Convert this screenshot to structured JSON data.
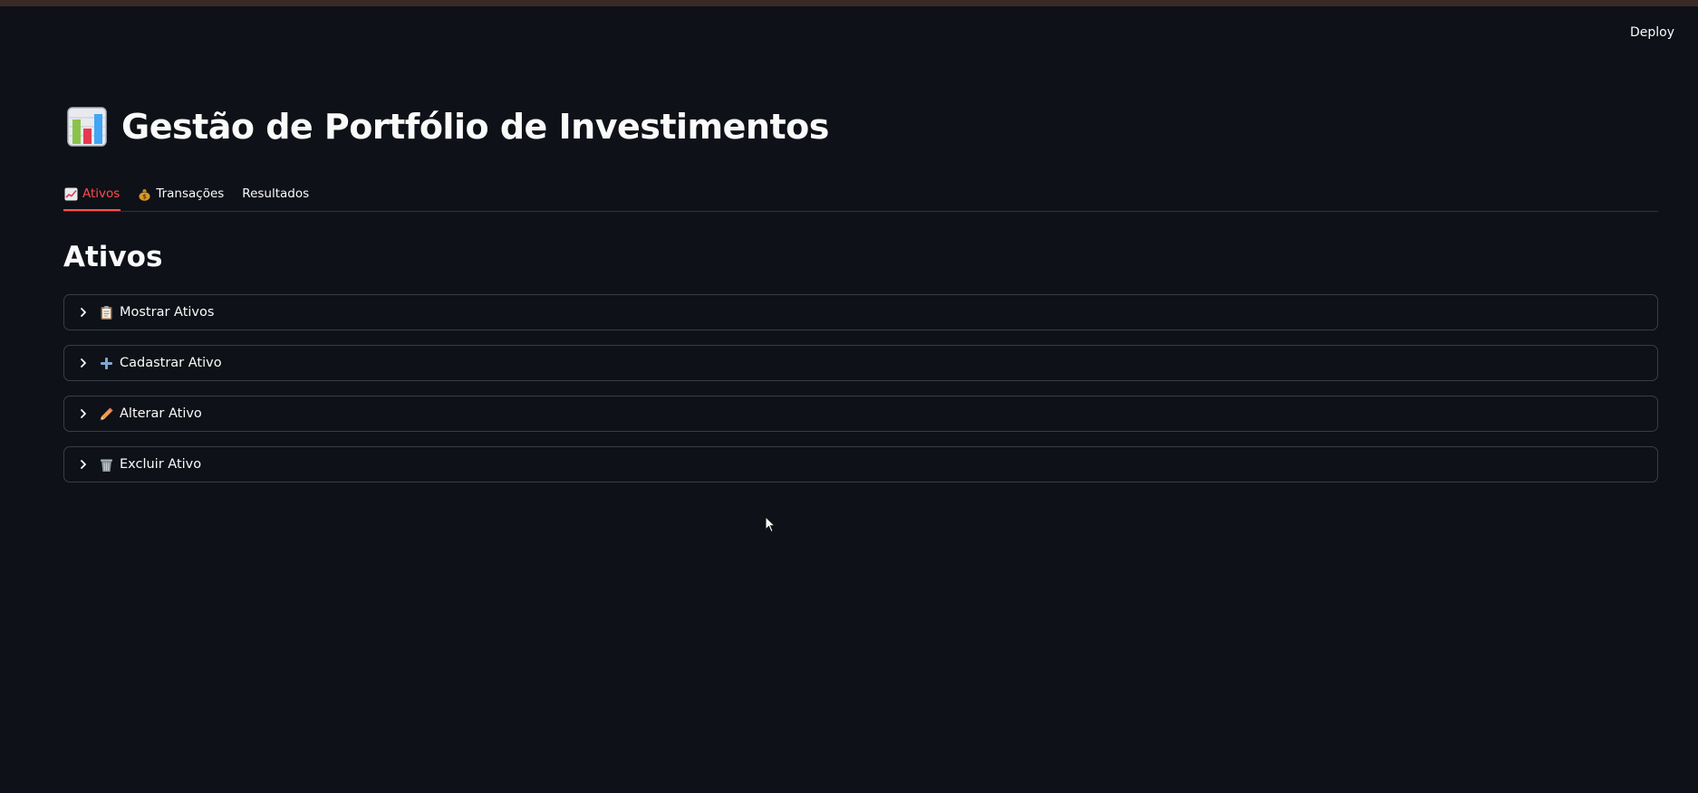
{
  "header": {
    "deploy_label": "Deploy"
  },
  "page": {
    "title": "Gestão de Portfólio de Investimentos",
    "title_icon": "bar-chart-emoji-icon"
  },
  "tabs": [
    {
      "label": "Ativos",
      "icon": "chart-increasing-icon",
      "active": true
    },
    {
      "label": "Transações",
      "icon": "money-bag-icon",
      "active": false
    },
    {
      "label": "Resultados",
      "icon": "",
      "active": false
    }
  ],
  "section": {
    "heading": "Ativos"
  },
  "expanders": [
    {
      "label": "Mostrar Ativos",
      "icon": "clipboard-icon"
    },
    {
      "label": "Cadastrar Ativo",
      "icon": "plus-icon"
    },
    {
      "label": "Alterar Ativo",
      "icon": "pencil-icon"
    },
    {
      "label": "Excluir Ativo",
      "icon": "wastebasket-icon"
    }
  ],
  "colors": {
    "background": "#0e1117",
    "accent": "#ff4b4b",
    "text": "#fafafa",
    "border": "#3a3d47"
  }
}
